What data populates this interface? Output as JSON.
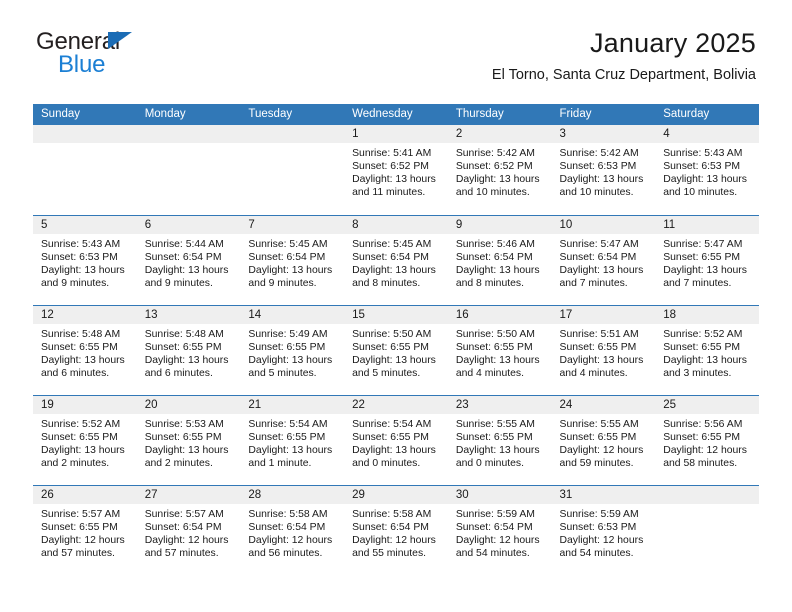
{
  "brand": {
    "word1": "General",
    "word2": "Blue",
    "triangle_color": "#1b6cb5",
    "word2_color": "#1b7fd4",
    "logo_icon": "triangle-icon"
  },
  "header": {
    "title": "January 2025",
    "subtitle": "El Torno, Santa Cruz Department, Bolivia"
  },
  "colors": {
    "header_blue": "#3178b7",
    "daynum_band": "#efefef",
    "text": "#1a1a1a"
  },
  "weekday_headers": [
    "Sunday",
    "Monday",
    "Tuesday",
    "Wednesday",
    "Thursday",
    "Friday",
    "Saturday"
  ],
  "weeks": [
    [
      {
        "day": "",
        "sunrise": "",
        "sunset": "",
        "daylight": ""
      },
      {
        "day": "",
        "sunrise": "",
        "sunset": "",
        "daylight": ""
      },
      {
        "day": "",
        "sunrise": "",
        "sunset": "",
        "daylight": ""
      },
      {
        "day": "1",
        "sunrise": "Sunrise: 5:41 AM",
        "sunset": "Sunset: 6:52 PM",
        "daylight": "Daylight: 13 hours and 11 minutes."
      },
      {
        "day": "2",
        "sunrise": "Sunrise: 5:42 AM",
        "sunset": "Sunset: 6:52 PM",
        "daylight": "Daylight: 13 hours and 10 minutes."
      },
      {
        "day": "3",
        "sunrise": "Sunrise: 5:42 AM",
        "sunset": "Sunset: 6:53 PM",
        "daylight": "Daylight: 13 hours and 10 minutes."
      },
      {
        "day": "4",
        "sunrise": "Sunrise: 5:43 AM",
        "sunset": "Sunset: 6:53 PM",
        "daylight": "Daylight: 13 hours and 10 minutes."
      }
    ],
    [
      {
        "day": "5",
        "sunrise": "Sunrise: 5:43 AM",
        "sunset": "Sunset: 6:53 PM",
        "daylight": "Daylight: 13 hours and 9 minutes."
      },
      {
        "day": "6",
        "sunrise": "Sunrise: 5:44 AM",
        "sunset": "Sunset: 6:54 PM",
        "daylight": "Daylight: 13 hours and 9 minutes."
      },
      {
        "day": "7",
        "sunrise": "Sunrise: 5:45 AM",
        "sunset": "Sunset: 6:54 PM",
        "daylight": "Daylight: 13 hours and 9 minutes."
      },
      {
        "day": "8",
        "sunrise": "Sunrise: 5:45 AM",
        "sunset": "Sunset: 6:54 PM",
        "daylight": "Daylight: 13 hours and 8 minutes."
      },
      {
        "day": "9",
        "sunrise": "Sunrise: 5:46 AM",
        "sunset": "Sunset: 6:54 PM",
        "daylight": "Daylight: 13 hours and 8 minutes."
      },
      {
        "day": "10",
        "sunrise": "Sunrise: 5:47 AM",
        "sunset": "Sunset: 6:54 PM",
        "daylight": "Daylight: 13 hours and 7 minutes."
      },
      {
        "day": "11",
        "sunrise": "Sunrise: 5:47 AM",
        "sunset": "Sunset: 6:55 PM",
        "daylight": "Daylight: 13 hours and 7 minutes."
      }
    ],
    [
      {
        "day": "12",
        "sunrise": "Sunrise: 5:48 AM",
        "sunset": "Sunset: 6:55 PM",
        "daylight": "Daylight: 13 hours and 6 minutes."
      },
      {
        "day": "13",
        "sunrise": "Sunrise: 5:48 AM",
        "sunset": "Sunset: 6:55 PM",
        "daylight": "Daylight: 13 hours and 6 minutes."
      },
      {
        "day": "14",
        "sunrise": "Sunrise: 5:49 AM",
        "sunset": "Sunset: 6:55 PM",
        "daylight": "Daylight: 13 hours and 5 minutes."
      },
      {
        "day": "15",
        "sunrise": "Sunrise: 5:50 AM",
        "sunset": "Sunset: 6:55 PM",
        "daylight": "Daylight: 13 hours and 5 minutes."
      },
      {
        "day": "16",
        "sunrise": "Sunrise: 5:50 AM",
        "sunset": "Sunset: 6:55 PM",
        "daylight": "Daylight: 13 hours and 4 minutes."
      },
      {
        "day": "17",
        "sunrise": "Sunrise: 5:51 AM",
        "sunset": "Sunset: 6:55 PM",
        "daylight": "Daylight: 13 hours and 4 minutes."
      },
      {
        "day": "18",
        "sunrise": "Sunrise: 5:52 AM",
        "sunset": "Sunset: 6:55 PM",
        "daylight": "Daylight: 13 hours and 3 minutes."
      }
    ],
    [
      {
        "day": "19",
        "sunrise": "Sunrise: 5:52 AM",
        "sunset": "Sunset: 6:55 PM",
        "daylight": "Daylight: 13 hours and 2 minutes."
      },
      {
        "day": "20",
        "sunrise": "Sunrise: 5:53 AM",
        "sunset": "Sunset: 6:55 PM",
        "daylight": "Daylight: 13 hours and 2 minutes."
      },
      {
        "day": "21",
        "sunrise": "Sunrise: 5:54 AM",
        "sunset": "Sunset: 6:55 PM",
        "daylight": "Daylight: 13 hours and 1 minute."
      },
      {
        "day": "22",
        "sunrise": "Sunrise: 5:54 AM",
        "sunset": "Sunset: 6:55 PM",
        "daylight": "Daylight: 13 hours and 0 minutes."
      },
      {
        "day": "23",
        "sunrise": "Sunrise: 5:55 AM",
        "sunset": "Sunset: 6:55 PM",
        "daylight": "Daylight: 13 hours and 0 minutes."
      },
      {
        "day": "24",
        "sunrise": "Sunrise: 5:55 AM",
        "sunset": "Sunset: 6:55 PM",
        "daylight": "Daylight: 12 hours and 59 minutes."
      },
      {
        "day": "25",
        "sunrise": "Sunrise: 5:56 AM",
        "sunset": "Sunset: 6:55 PM",
        "daylight": "Daylight: 12 hours and 58 minutes."
      }
    ],
    [
      {
        "day": "26",
        "sunrise": "Sunrise: 5:57 AM",
        "sunset": "Sunset: 6:55 PM",
        "daylight": "Daylight: 12 hours and 57 minutes."
      },
      {
        "day": "27",
        "sunrise": "Sunrise: 5:57 AM",
        "sunset": "Sunset: 6:54 PM",
        "daylight": "Daylight: 12 hours and 57 minutes."
      },
      {
        "day": "28",
        "sunrise": "Sunrise: 5:58 AM",
        "sunset": "Sunset: 6:54 PM",
        "daylight": "Daylight: 12 hours and 56 minutes."
      },
      {
        "day": "29",
        "sunrise": "Sunrise: 5:58 AM",
        "sunset": "Sunset: 6:54 PM",
        "daylight": "Daylight: 12 hours and 55 minutes."
      },
      {
        "day": "30",
        "sunrise": "Sunrise: 5:59 AM",
        "sunset": "Sunset: 6:54 PM",
        "daylight": "Daylight: 12 hours and 54 minutes."
      },
      {
        "day": "31",
        "sunrise": "Sunrise: 5:59 AM",
        "sunset": "Sunset: 6:53 PM",
        "daylight": "Daylight: 12 hours and 54 minutes."
      },
      {
        "day": "",
        "sunrise": "",
        "sunset": "",
        "daylight": ""
      }
    ]
  ]
}
